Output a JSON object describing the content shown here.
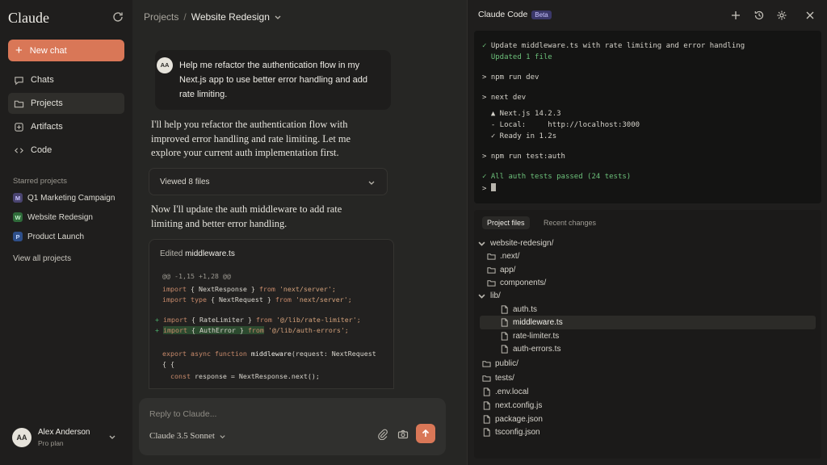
{
  "sidebar": {
    "logo": "Claude",
    "new_chat_label": "New chat",
    "nav": [
      {
        "label": "Chats",
        "icon": "chat-bubble-icon"
      },
      {
        "label": "Projects",
        "icon": "folder-icon",
        "active": true
      },
      {
        "label": "Artifacts",
        "icon": "artifact-icon"
      },
      {
        "label": "Code",
        "icon": "code-icon"
      }
    ],
    "starred_heading": "Starred projects",
    "projects": [
      {
        "badge": "M",
        "label": "Q1 Marketing Campaign",
        "color": "#4a4470",
        "text_color": "#c9c3ff"
      },
      {
        "badge": "W",
        "label": "Website Redesign",
        "color": "#2f6b3a",
        "text_color": "#bff0c8"
      },
      {
        "badge": "P",
        "label": "Product Launch",
        "color": "#2e4f8a",
        "text_color": "#c4d8ff"
      }
    ],
    "view_all": "View all projects",
    "user": {
      "initials": "AA",
      "name": "Alex Anderson",
      "plan": "Pro plan"
    }
  },
  "chat": {
    "breadcrumb": {
      "parent": "Projects",
      "separator": "/",
      "current": "Website Redesign"
    },
    "user_message": {
      "initials": "AA",
      "text": "Help me refactor the authentication flow in my Next.js app to use better error handling and add rate limiting."
    },
    "assistant_1": "I'll help you refactor the authentication flow with improved error handling and rate limiting. Let me explore your current auth implementation first.",
    "viewed_files": "Viewed 8 files",
    "assistant_2": "Now I'll update the auth middleware to add rate limiting and better error handling.",
    "code_card": {
      "title_prefix": "Edited ",
      "title_file": "middleware.ts",
      "hunk": "@@ -1,15 +1,28 @@",
      "lines": [
        {
          "kw": "import",
          "mid": " { NextResponse } ",
          "kw2": "from",
          "str": " 'next/server';"
        },
        {
          "kw": "import type",
          "mid": " { NextRequest } ",
          "kw2": "from",
          "str": " 'next/server';"
        },
        {
          "plus": "+ ",
          "kw": "import",
          "mid": " { RateLimiter } ",
          "kw2": "from",
          "str": " '@/lib/rate-limiter';"
        },
        {
          "plus": "+ ",
          "kw": "import",
          "mid": " { AuthError } ",
          "kw2": "from",
          "str": " '@/lib/auth-errors';"
        }
      ],
      "fn_line_kw": "export async function ",
      "fn_line_name": "middleware",
      "fn_line_rest": "(request: NextRequest",
      "brace_line": "{ {",
      "const_line_kw": "  const ",
      "const_line_rest": "response = NextResponse.next();"
    },
    "reply_placeholder": "Reply to Claude...",
    "model": "Claude 3.5 Sonnet"
  },
  "claude_code": {
    "title": "Claude Code",
    "beta": "Beta",
    "terminal": [
      {
        "text": "✓ Update middleware.ts with rate limiting and error handling",
        "style": "green-check"
      },
      {
        "text": "  Updated 1 file",
        "style": "green"
      },
      {
        "text": "> npm run dev",
        "style": "normal"
      },
      {
        "text": "> next dev",
        "style": "normal"
      },
      {
        "text": "  ▲ Next.js 14.2.3",
        "style": "normal"
      },
      {
        "text": "  - Local:     http://localhost:3000",
        "style": "normal"
      },
      {
        "text": "  ✓ Ready in 1.2s",
        "style": "normal"
      },
      {
        "text": "> npm run test:auth",
        "style": "normal"
      },
      {
        "text": "✓ All auth tests passed (24 tests)",
        "style": "green"
      },
      {
        "text": "> ",
        "style": "prompt"
      }
    ],
    "tabs": [
      "Project files",
      "Recent changes"
    ],
    "tree": [
      {
        "label": "website-redesign/",
        "type": "root"
      },
      {
        "label": ".next/",
        "type": "folder"
      },
      {
        "label": "app/",
        "type": "folder"
      },
      {
        "label": "components/",
        "type": "folder"
      },
      {
        "label": "lib/",
        "type": "folder-open"
      },
      {
        "label": "auth.ts",
        "type": "file"
      },
      {
        "label": "middleware.ts",
        "type": "file",
        "selected": true
      },
      {
        "label": "rate-limiter.ts",
        "type": "file"
      },
      {
        "label": "auth-errors.ts",
        "type": "file"
      },
      {
        "label": "public/",
        "type": "folder"
      },
      {
        "label": "tests/",
        "type": "folder"
      },
      {
        "label": ".env.local",
        "type": "file"
      },
      {
        "label": "next.config.js",
        "type": "file"
      },
      {
        "label": "package.json",
        "type": "file"
      },
      {
        "label": "tsconfig.json",
        "type": "file"
      }
    ]
  },
  "colors": {
    "accent": "#d97757",
    "terminal_green": "#6cc07a",
    "beta_bg": "#3b3869"
  }
}
